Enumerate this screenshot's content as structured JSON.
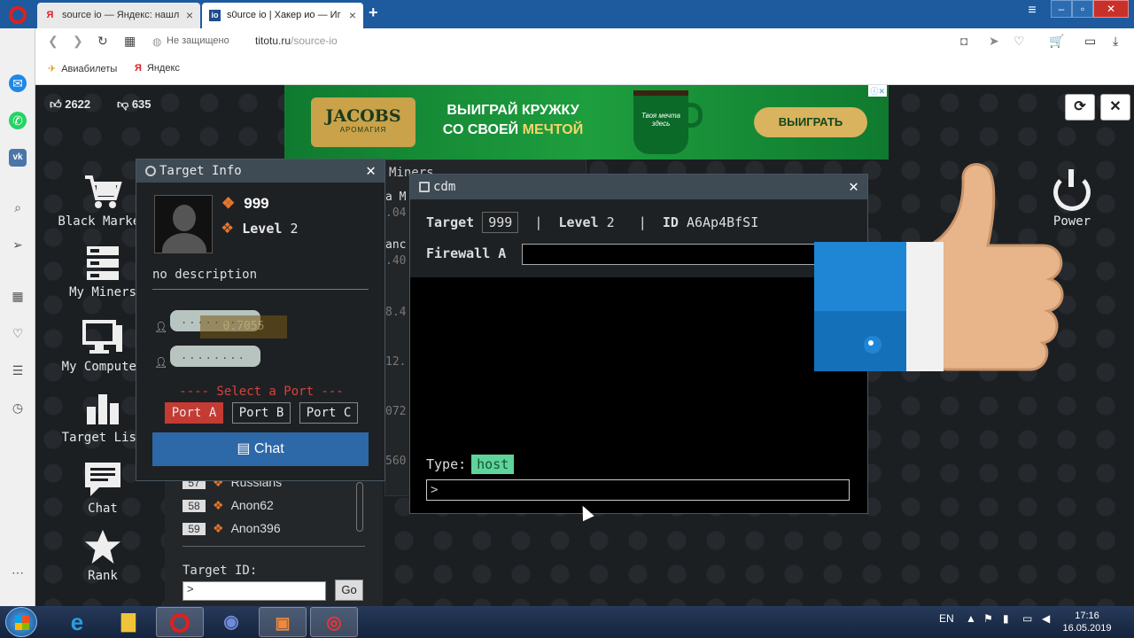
{
  "browser": {
    "tabs": [
      {
        "title": "source io — Яндекс: нашл",
        "favicon": "Я",
        "active": false
      },
      {
        "title": "s0urce io | Хакер ио — Иг",
        "favicon": "io",
        "active": true
      }
    ],
    "address": {
      "insecure_label": "Не защищено",
      "domain": "titotu.ru",
      "path": "/source-io"
    },
    "bookmarks": [
      {
        "label": "Авиабилеты",
        "icon": "plane-icon"
      },
      {
        "label": "Яндекс",
        "icon": "yandex-icon"
      }
    ]
  },
  "game": {
    "likes": "2622",
    "dislikes": "635",
    "ad": {
      "brand": "JACOBS",
      "brand_sub": "АРОМАГИЯ",
      "line1": "ВЫИГРАЙ КРУЖКУ",
      "line2_prefix": "СО СВОЕЙ",
      "line2_highlight": "МЕЧТОЙ",
      "cup_text": "Твоя мечта здесь",
      "button": "ВЫИГРАТЬ"
    },
    "menu": [
      {
        "label": "Black Market",
        "icon": "cart-icon"
      },
      {
        "label": "My Miners",
        "icon": "server-icon"
      },
      {
        "label": "My Computer",
        "icon": "monitor-icon"
      },
      {
        "label": "Target List",
        "icon": "bar-chart-icon"
      },
      {
        "label": "Chat",
        "icon": "chat-icon"
      },
      {
        "label": "Rank",
        "icon": "star-icon"
      }
    ],
    "power_label": "Power",
    "miners_panel": {
      "header": "Miners",
      "rows": [
        "a M",
        ".04",
        "anc",
        ".40",
        "8.4",
        "12.",
        "072",
        "560"
      ]
    },
    "target_list": {
      "rows": [
        {
          "num": "57",
          "name": "Russians"
        },
        {
          "num": "58",
          "name": "Anon62"
        },
        {
          "num": "59",
          "name": "Anon396"
        }
      ],
      "target_id_label": "Target ID:",
      "target_id_value": ">",
      "go_label": "Go"
    },
    "target_info": {
      "title": "Target Info",
      "score": "999",
      "level_label": "Level",
      "level_value": "2",
      "description": "no description",
      "bubble1": "........",
      "bubble2": "........",
      "bubble_overlay": "0.7055",
      "select_port": "---- Select a Port ---",
      "ports": [
        "Port A",
        "Port B",
        "Port C"
      ],
      "active_port": "Port A",
      "chat_label": "Chat"
    },
    "cdm": {
      "title": "cdm",
      "target_label": "Target",
      "target_value": "999",
      "level_label": "Level",
      "level_value": "2",
      "id_label": "ID",
      "id_value": "A6Ap4BfSI",
      "firewall_label": "Firewall A",
      "type_label": "Type:",
      "type_value": "host",
      "cmd_prompt": ">"
    }
  },
  "taskbar": {
    "lang": "EN",
    "time": "17:16",
    "date": "16.05.2019"
  }
}
